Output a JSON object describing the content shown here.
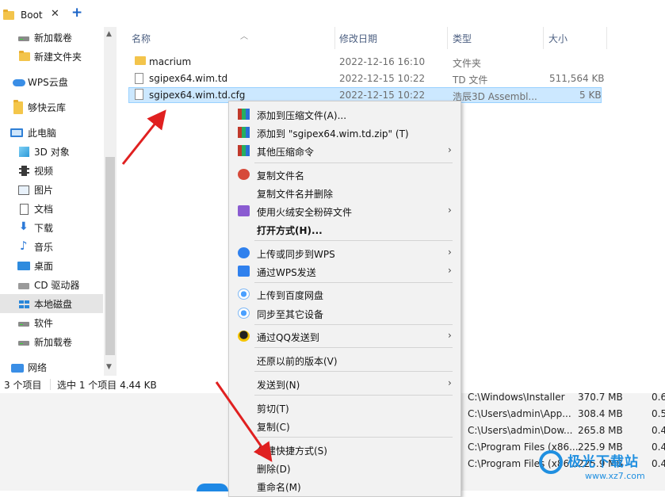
{
  "tab": {
    "title": "Boot",
    "close_glyph": "✕",
    "add_glyph": "+"
  },
  "nav": {
    "items": [
      {
        "label": "新加载卷",
        "icon": "drive-icon"
      },
      {
        "label": "新建文件夹",
        "icon": "folder-icon"
      },
      {
        "label": "WPS云盘",
        "icon": "cloud-icon"
      },
      {
        "label": "够快云库",
        "icon": "folder-icon"
      },
      {
        "label": "此电脑",
        "icon": "computer-icon"
      },
      {
        "label": "3D 对象",
        "icon": "3d-objects-icon"
      },
      {
        "label": "视频",
        "icon": "video-icon"
      },
      {
        "label": "图片",
        "icon": "pictures-icon"
      },
      {
        "label": "文档",
        "icon": "documents-icon"
      },
      {
        "label": "下载",
        "icon": "download-icon"
      },
      {
        "label": "音乐",
        "icon": "music-icon"
      },
      {
        "label": "桌面",
        "icon": "desktop-icon"
      },
      {
        "label": "CD 驱动器",
        "icon": "cd-drive-icon"
      },
      {
        "label": "本地磁盘",
        "icon": "local-disk-icon",
        "selected": true
      },
      {
        "label": "软件",
        "icon": "drive-icon"
      },
      {
        "label": "新加载卷",
        "icon": "drive-icon"
      },
      {
        "label": "网络",
        "icon": "network-icon"
      }
    ]
  },
  "columns": {
    "name": "名称",
    "date": "修改日期",
    "type": "类型",
    "size": "大小"
  },
  "files": [
    {
      "name": "macrium",
      "date": "2022-12-16 16:10",
      "type": "文件夹",
      "size": ""
    },
    {
      "name": "sgipex64.wim.td",
      "date": "2022-12-15 10:22",
      "type": "TD 文件",
      "size": "511,564 KB"
    },
    {
      "name": "sgipex64.wim.td.cfg",
      "date": "2022-12-15 10:22",
      "type": "浩辰3D Assembl...",
      "size": "5 KB"
    }
  ],
  "status": {
    "count": "3 个项目",
    "selection": "选中 1 个项目  4.44 KB"
  },
  "background_rows": [
    {
      "path": "C:\\Windows\\Installer",
      "size": "370.7 MB",
      "extra": "0.6"
    },
    {
      "path": "C:\\Users\\admin\\App...",
      "size": "308.4 MB",
      "extra": "0.5"
    },
    {
      "path": "C:\\Users\\admin\\Dow...",
      "size": "265.8 MB",
      "extra": "0.4"
    },
    {
      "path": "C:\\Program Files (x86...",
      "size": "225.9 MB",
      "extra": "0.4"
    },
    {
      "path": "C:\\Program Files (x86...",
      "size": "225.9 MB",
      "extra": "0.4"
    }
  ],
  "menu": {
    "add_archive": "添加到压缩文件(A)...",
    "add_zip": "添加到 \"sgipex64.wim.td.zip\" (T)",
    "other_compress": "其他压缩命令",
    "copy_name": "复制文件名",
    "copy_name_delete": "复制文件名并删除",
    "shred": "使用火绒安全粉碎文件",
    "open_with": "打开方式(H)...",
    "upload_wps": "上传或同步到WPS",
    "send_wps": "通过WPS发送",
    "upload_baidu": "上传到百度网盘",
    "sync_devices": "同步至其它设备",
    "send_qq": "通过QQ发送到",
    "restore_prev": "还原以前的版本(V)",
    "send_to": "发送到(N)",
    "cut": "剪切(T)",
    "copy": "复制(C)",
    "create_shortcut": "创建快捷方式(S)",
    "delete": "删除(D)",
    "rename": "重命名(M)",
    "submenu_glyph": "›"
  },
  "watermark": {
    "title": "极光下载站",
    "url": "www.xz7.com"
  },
  "colors": {
    "accent": "#1a63c7",
    "selection": "#cce8ff",
    "annotation": "#e02020"
  }
}
